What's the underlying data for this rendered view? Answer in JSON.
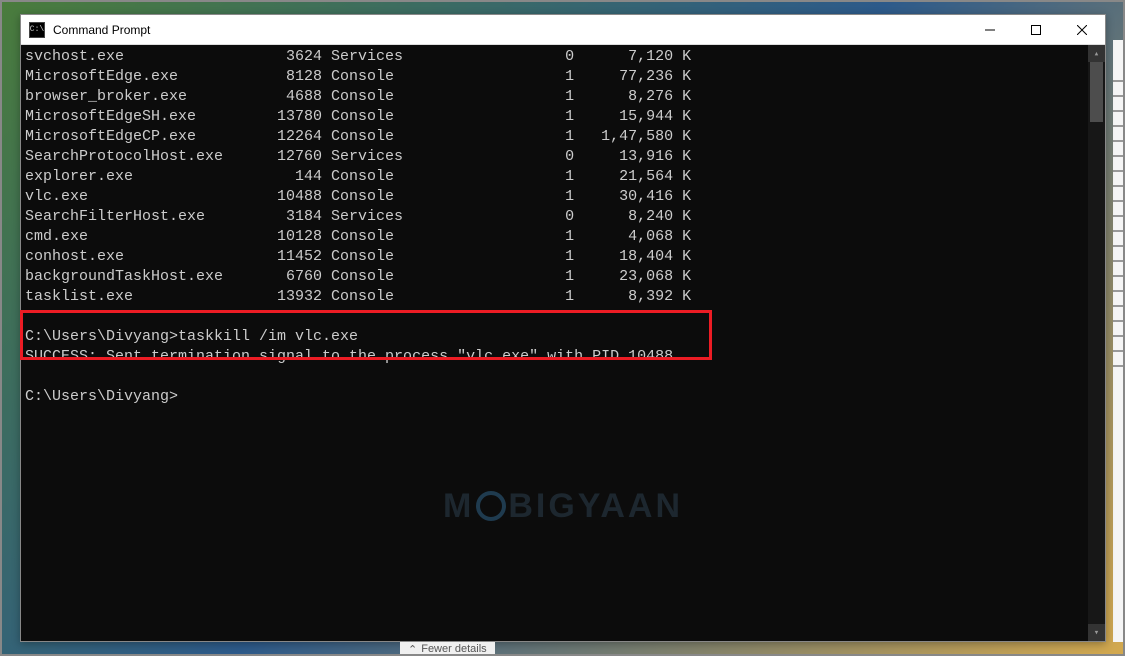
{
  "window": {
    "title": "Command Prompt"
  },
  "processes": [
    {
      "name": "svchost.exe",
      "pid": "3624",
      "session_name": "Services",
      "session_num": "0",
      "mem": "7,120 K"
    },
    {
      "name": "MicrosoftEdge.exe",
      "pid": "8128",
      "session_name": "Console",
      "session_num": "1",
      "mem": "77,236 K"
    },
    {
      "name": "browser_broker.exe",
      "pid": "4688",
      "session_name": "Console",
      "session_num": "1",
      "mem": "8,276 K"
    },
    {
      "name": "MicrosoftEdgeSH.exe",
      "pid": "13780",
      "session_name": "Console",
      "session_num": "1",
      "mem": "15,944 K"
    },
    {
      "name": "MicrosoftEdgeCP.exe",
      "pid": "12264",
      "session_name": "Console",
      "session_num": "1",
      "mem": "1,47,580 K"
    },
    {
      "name": "SearchProtocolHost.exe",
      "pid": "12760",
      "session_name": "Services",
      "session_num": "0",
      "mem": "13,916 K"
    },
    {
      "name": "explorer.exe",
      "pid": "144",
      "session_name": "Console",
      "session_num": "1",
      "mem": "21,564 K"
    },
    {
      "name": "vlc.exe",
      "pid": "10488",
      "session_name": "Console",
      "session_num": "1",
      "mem": "30,416 K"
    },
    {
      "name": "SearchFilterHost.exe",
      "pid": "3184",
      "session_name": "Services",
      "session_num": "0",
      "mem": "8,240 K"
    },
    {
      "name": "cmd.exe",
      "pid": "10128",
      "session_name": "Console",
      "session_num": "1",
      "mem": "4,068 K"
    },
    {
      "name": "conhost.exe",
      "pid": "11452",
      "session_name": "Console",
      "session_num": "1",
      "mem": "18,404 K"
    },
    {
      "name": "backgroundTaskHost.exe",
      "pid": "6760",
      "session_name": "Console",
      "session_num": "1",
      "mem": "23,068 K"
    },
    {
      "name": "tasklist.exe",
      "pid": "13932",
      "session_name": "Console",
      "session_num": "1",
      "mem": "8,392 K"
    }
  ],
  "command": {
    "prompt1": "C:\\Users\\Divyang>",
    "cmd": "taskkill /im vlc.exe",
    "result": "SUCCESS: Sent termination signal to the process \"vlc.exe\" with PID 10488.",
    "prompt2": "C:\\Users\\Divyang>"
  },
  "watermark": {
    "part1": "M",
    "part2": "BIGYAAN"
  },
  "bg": {
    "fewer_details": "Fewer details"
  }
}
